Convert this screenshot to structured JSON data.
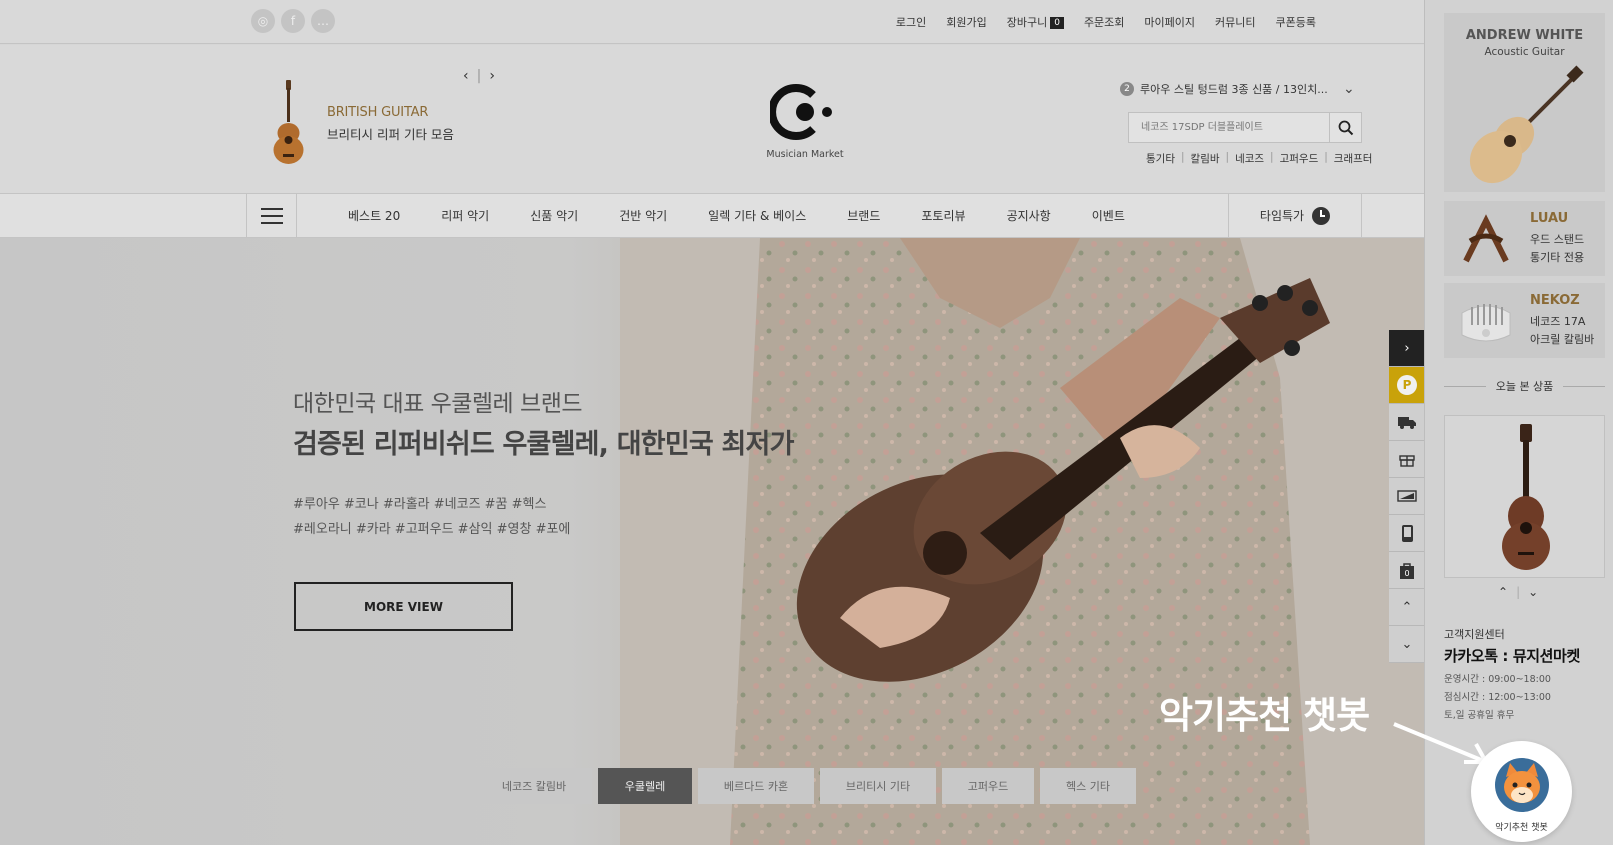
{
  "topbar": {
    "sns": [
      "instagram-icon",
      "facebook-icon",
      "talk-icon"
    ],
    "links": [
      "로그인",
      "회원가입",
      "장바구니",
      "주문조회",
      "마이페이지",
      "커뮤니티",
      "쿠폰등록"
    ],
    "cart_count": "0"
  },
  "header": {
    "promo": {
      "title": "BRITISH GUITAR",
      "subtitle": "브리티시 리퍼 기타 모음"
    },
    "logo": {
      "caption": "Musician Market"
    },
    "notice": {
      "number": "2",
      "text": "루아우 스틸 텅드럼 3종 신품 / 13인치..."
    },
    "search": {
      "placeholder": "네코즈 17SDP 더블플레이트"
    },
    "keywords": [
      "통기타",
      "칼림바",
      "네코즈",
      "고퍼우드",
      "크래프터"
    ]
  },
  "nav": {
    "items": [
      "베스트 20",
      "리퍼 악기",
      "신품 악기",
      "건반 악기",
      "일렉 기타 & 베이스",
      "브랜드",
      "포토리뷰",
      "공지사항",
      "이벤트"
    ],
    "timesale": "타임특가"
  },
  "hero": {
    "subtitle": "대한민국 대표 우쿨렐레 브랜드",
    "title": "검증된 리퍼비쉬드 우쿨렐레, 대한민국 최저가",
    "tags_line1": "#루아우 #코나 #라홀라 #네코즈 #꿈 #헥스",
    "tags_line2": "#레오라니 #카라 #고퍼우드 #삼익 #영창 #포에",
    "button": "MORE VIEW",
    "tabs": [
      {
        "label": "네코즈 칼림바",
        "active": false
      },
      {
        "label": "우쿨렐레",
        "active": true
      },
      {
        "label": "베르다드 카혼",
        "active": false
      },
      {
        "label": "브리티시 기타",
        "active": false
      },
      {
        "label": "고퍼우드",
        "active": false
      },
      {
        "label": "헥스 기타",
        "active": false
      }
    ]
  },
  "quickbar": {
    "items": [
      "arrow-right-icon",
      "coin-icon",
      "truck-icon",
      "gift-icon",
      "coupon-icon",
      "phone-icon",
      "bag-icon",
      "arrow-up-icon",
      "arrow-down-icon"
    ],
    "bag_count": "0"
  },
  "sidebar": {
    "card1": {
      "title": "ANDREW WHITE",
      "subtitle": "Acoustic Guitar"
    },
    "card2": {
      "brand": "LUAU",
      "line1": "우드 스탠드",
      "line2": "통기타 전용"
    },
    "card3": {
      "brand": "NEKOZ",
      "line1": "네코즈 17A",
      "line2": "아크릴 칼림바"
    },
    "today_title": "오늘 본 상품",
    "cs": {
      "label": "고객지원센터",
      "kakao": "카카오톡 : 뮤지션마켓",
      "hours": "운영시간 : 09:00~18:00",
      "lunch": "점심시간 : 12:00~13:00",
      "holiday": "토,일 공휴일 휴무"
    }
  },
  "chatbot": {
    "label": "악기추천 챗봇",
    "button_label": "악기추천 챗봇"
  },
  "colors": {
    "accent_gold": "#8a6a36",
    "quick_yellow": "#c9a20a",
    "dark": "#222222"
  }
}
